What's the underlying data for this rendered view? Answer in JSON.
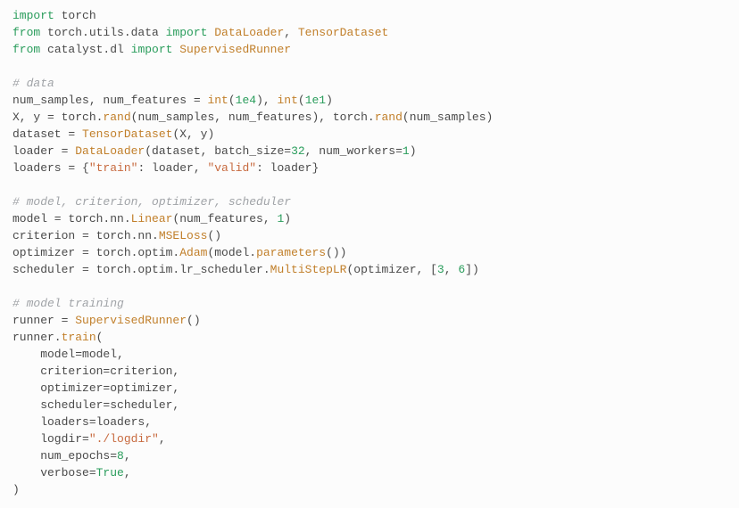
{
  "code": {
    "l1": [
      {
        "t": "import ",
        "c": "kw"
      },
      {
        "t": "torch",
        "c": "nm"
      }
    ],
    "l2": [
      {
        "t": "from ",
        "c": "kw"
      },
      {
        "t": "torch.utils.data ",
        "c": "nm"
      },
      {
        "t": "import ",
        "c": "kw"
      },
      {
        "t": "DataLoader",
        "c": "fn"
      },
      {
        "t": ", ",
        "c": "nm"
      },
      {
        "t": "TensorDataset",
        "c": "fn"
      }
    ],
    "l3": [
      {
        "t": "from ",
        "c": "kw"
      },
      {
        "t": "catalyst.dl ",
        "c": "nm"
      },
      {
        "t": "import ",
        "c": "kw"
      },
      {
        "t": "SupervisedRunner",
        "c": "fn"
      }
    ],
    "l4": [],
    "l5": [
      {
        "t": "# data",
        "c": "cmt"
      }
    ],
    "l6": [
      {
        "t": "num_samples, num_features = ",
        "c": "nm"
      },
      {
        "t": "int",
        "c": "fn"
      },
      {
        "t": "(",
        "c": "nm"
      },
      {
        "t": "1e4",
        "c": "num"
      },
      {
        "t": "), ",
        "c": "nm"
      },
      {
        "t": "int",
        "c": "fn"
      },
      {
        "t": "(",
        "c": "nm"
      },
      {
        "t": "1e1",
        "c": "num"
      },
      {
        "t": ")",
        "c": "nm"
      }
    ],
    "l7": [
      {
        "t": "X, y = torch.",
        "c": "nm"
      },
      {
        "t": "rand",
        "c": "fn"
      },
      {
        "t": "(num_samples, num_features), torch.",
        "c": "nm"
      },
      {
        "t": "rand",
        "c": "fn"
      },
      {
        "t": "(num_samples)",
        "c": "nm"
      }
    ],
    "l8": [
      {
        "t": "dataset = ",
        "c": "nm"
      },
      {
        "t": "TensorDataset",
        "c": "fn"
      },
      {
        "t": "(X, y)",
        "c": "nm"
      }
    ],
    "l9": [
      {
        "t": "loader = ",
        "c": "nm"
      },
      {
        "t": "DataLoader",
        "c": "fn"
      },
      {
        "t": "(dataset, batch_size=",
        "c": "nm"
      },
      {
        "t": "32",
        "c": "num"
      },
      {
        "t": ", num_workers=",
        "c": "nm"
      },
      {
        "t": "1",
        "c": "num"
      },
      {
        "t": ")",
        "c": "nm"
      }
    ],
    "l10": [
      {
        "t": "loaders = {",
        "c": "nm"
      },
      {
        "t": "\"train\"",
        "c": "str"
      },
      {
        "t": ": loader, ",
        "c": "nm"
      },
      {
        "t": "\"valid\"",
        "c": "str"
      },
      {
        "t": ": loader}",
        "c": "nm"
      }
    ],
    "l11": [],
    "l12": [
      {
        "t": "# model, criterion, optimizer, scheduler",
        "c": "cmt"
      }
    ],
    "l13": [
      {
        "t": "model = torch.nn.",
        "c": "nm"
      },
      {
        "t": "Linear",
        "c": "fn"
      },
      {
        "t": "(num_features, ",
        "c": "nm"
      },
      {
        "t": "1",
        "c": "num"
      },
      {
        "t": ")",
        "c": "nm"
      }
    ],
    "l14": [
      {
        "t": "criterion = torch.nn.",
        "c": "nm"
      },
      {
        "t": "MSELoss",
        "c": "fn"
      },
      {
        "t": "()",
        "c": "nm"
      }
    ],
    "l15": [
      {
        "t": "optimizer = torch.optim.",
        "c": "nm"
      },
      {
        "t": "Adam",
        "c": "fn"
      },
      {
        "t": "(model.",
        "c": "nm"
      },
      {
        "t": "parameters",
        "c": "fn"
      },
      {
        "t": "())",
        "c": "nm"
      }
    ],
    "l16": [
      {
        "t": "scheduler = torch.optim.lr_scheduler.",
        "c": "nm"
      },
      {
        "t": "MultiStepLR",
        "c": "fn"
      },
      {
        "t": "(optimizer, [",
        "c": "nm"
      },
      {
        "t": "3",
        "c": "num"
      },
      {
        "t": ", ",
        "c": "nm"
      },
      {
        "t": "6",
        "c": "num"
      },
      {
        "t": "])",
        "c": "nm"
      }
    ],
    "l17": [],
    "l18": [
      {
        "t": "# model training",
        "c": "cmt"
      }
    ],
    "l19": [
      {
        "t": "runner = ",
        "c": "nm"
      },
      {
        "t": "SupervisedRunner",
        "c": "fn"
      },
      {
        "t": "()",
        "c": "nm"
      }
    ],
    "l20": [
      {
        "t": "runner.",
        "c": "nm"
      },
      {
        "t": "train",
        "c": "fn"
      },
      {
        "t": "(",
        "c": "nm"
      }
    ],
    "l21": [
      {
        "t": "    model=model,",
        "c": "nm"
      }
    ],
    "l22": [
      {
        "t": "    criterion=criterion,",
        "c": "nm"
      }
    ],
    "l23": [
      {
        "t": "    optimizer=optimizer,",
        "c": "nm"
      }
    ],
    "l24": [
      {
        "t": "    scheduler=scheduler,",
        "c": "nm"
      }
    ],
    "l25": [
      {
        "t": "    loaders=loaders,",
        "c": "nm"
      }
    ],
    "l26": [
      {
        "t": "    logdir=",
        "c": "nm"
      },
      {
        "t": "\"./logdir\"",
        "c": "str"
      },
      {
        "t": ",",
        "c": "nm"
      }
    ],
    "l27": [
      {
        "t": "    num_epochs=",
        "c": "nm"
      },
      {
        "t": "8",
        "c": "num"
      },
      {
        "t": ",",
        "c": "nm"
      }
    ],
    "l28": [
      {
        "t": "    verbose=",
        "c": "nm"
      },
      {
        "t": "True",
        "c": "bool"
      },
      {
        "t": ",",
        "c": "nm"
      }
    ],
    "l29": [
      {
        "t": ")",
        "c": "nm"
      }
    ]
  },
  "lineOrder": [
    "l1",
    "l2",
    "l3",
    "l4",
    "l5",
    "l6",
    "l7",
    "l8",
    "l9",
    "l10",
    "l11",
    "l12",
    "l13",
    "l14",
    "l15",
    "l16",
    "l17",
    "l18",
    "l19",
    "l20",
    "l21",
    "l22",
    "l23",
    "l24",
    "l25",
    "l26",
    "l27",
    "l28",
    "l29"
  ]
}
